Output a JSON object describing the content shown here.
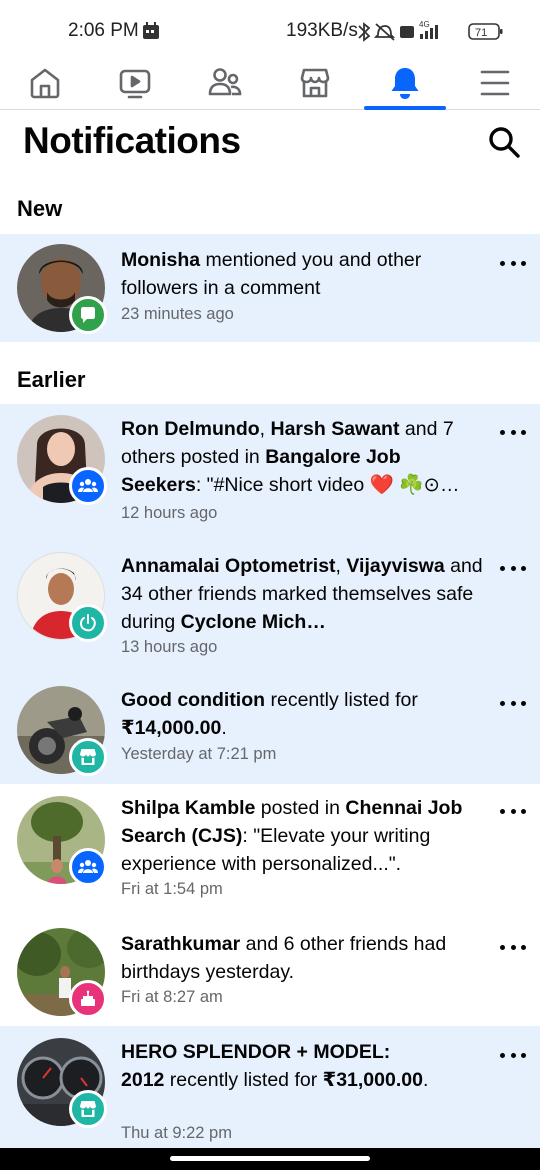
{
  "status_bar": {
    "time": "2:06 PM",
    "network_speed": "193KB/s",
    "network_type": "4G",
    "battery": "71"
  },
  "nav": {
    "tabs": [
      {
        "icon": "home-icon"
      },
      {
        "icon": "video-icon"
      },
      {
        "icon": "friends-icon"
      },
      {
        "icon": "marketplace-icon"
      },
      {
        "icon": "notifications-bell-icon",
        "active": true
      },
      {
        "icon": "menu-icon"
      }
    ],
    "accent": "#0866ff"
  },
  "header": {
    "title": "Notifications"
  },
  "sections": {
    "new_label": "New",
    "earlier_label": "Earlier"
  },
  "notifications": [
    {
      "parts": [
        [
          "b",
          "Monisha"
        ],
        [
          "t",
          " mentioned you and other followers in a comment"
        ]
      ],
      "time": "23 minutes ago",
      "badge": "comment-badge-icon",
      "unread": true
    },
    {
      "parts": [
        [
          "b",
          "Ron Delmundo"
        ],
        [
          "t",
          ", "
        ],
        [
          "b",
          "Harsh Sawant"
        ],
        [
          "t",
          " and 7 others posted in "
        ],
        [
          "b",
          "Bangalore Job Seekers"
        ],
        [
          "t",
          ": \"#Nice short video ❤️ ☘️⊙…"
        ]
      ],
      "time": "12 hours ago",
      "badge": "group-badge-icon",
      "unread": true
    },
    {
      "parts": [
        [
          "b",
          "Annamalai Optometrist"
        ],
        [
          "t",
          ", "
        ],
        [
          "b",
          "Vijayviswa"
        ],
        [
          "t",
          " and 34 other friends marked themselves safe during "
        ],
        [
          "b",
          "Cyclone Mich…"
        ]
      ],
      "time": "13 hours ago",
      "badge": "safety-check-badge-icon",
      "unread": true
    },
    {
      "parts": [
        [
          "b",
          "Good condition"
        ],
        [
          "t",
          " recently listed for "
        ],
        [
          "b",
          "₹14,000.00"
        ],
        [
          "t",
          "."
        ]
      ],
      "time": "Yesterday at 7:21 pm",
      "badge": "marketplace-badge-icon",
      "unread": true
    },
    {
      "parts": [
        [
          "b",
          "Shilpa Kamble"
        ],
        [
          "t",
          " posted in "
        ],
        [
          "b",
          "Chennai Job Search (CJS)"
        ],
        [
          "t",
          ": \"Elevate your writing experience with personalized...\"."
        ]
      ],
      "time": "Fri at 1:54 pm",
      "badge": "group-badge-icon",
      "unread": false
    },
    {
      "parts": [
        [
          "b",
          "Sarathkumar"
        ],
        [
          "t",
          " and 6 other friends had birthdays yesterday."
        ]
      ],
      "time": "Fri at 8:27 am",
      "badge": "birthday-cake-badge-icon",
      "unread": false
    },
    {
      "parts": [
        [
          "b",
          "HERO SPLENDOR + MODEL: 2012"
        ],
        [
          "t",
          " recently listed for "
        ],
        [
          "b",
          "₹31,000.00"
        ],
        [
          "t",
          "."
        ]
      ],
      "time": "Thu at 9:22 pm",
      "badge": "marketplace-badge-icon",
      "unread": true
    }
  ],
  "colors": {
    "unread_bg": "#e7f0fd",
    "comment_badge": "#31a24c",
    "group_badge": "#0866ff",
    "safety_badge": "#1fb6a6",
    "marketplace_badge": "#1fb6a6",
    "birthday_badge": "#e8337a"
  }
}
